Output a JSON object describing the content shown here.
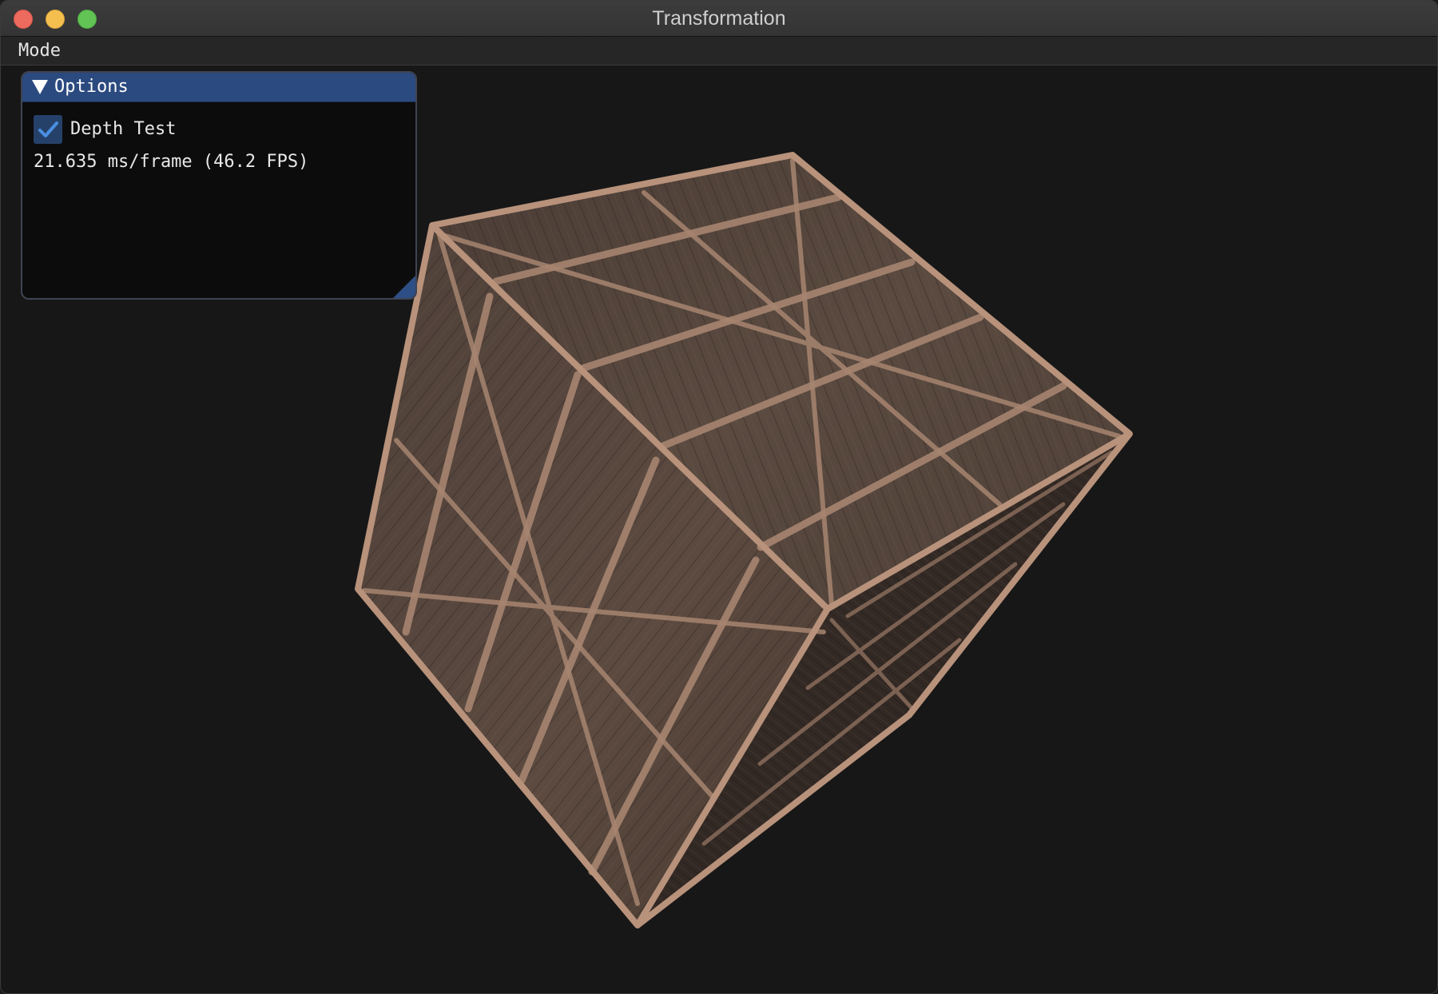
{
  "window": {
    "title": "Transformation"
  },
  "menubar": {
    "items": [
      {
        "label": "Mode"
      }
    ]
  },
  "options_panel": {
    "title": "Options",
    "collapse_icon": "triangle-down-icon",
    "depth_test": {
      "label": "Depth Test",
      "checked": true
    },
    "frame_stats": "21.635 ms/frame (46.2 FPS)"
  },
  "scene": {
    "object": "wooden-crate",
    "background_color": "#171717"
  },
  "colors": {
    "panel_header": "#2b4a7f",
    "checkbox_bg": "#264169",
    "checkmark": "#4a8fe0",
    "close": "#ed6a5e",
    "minimize": "#f5bf4f",
    "maximize": "#61c454"
  }
}
